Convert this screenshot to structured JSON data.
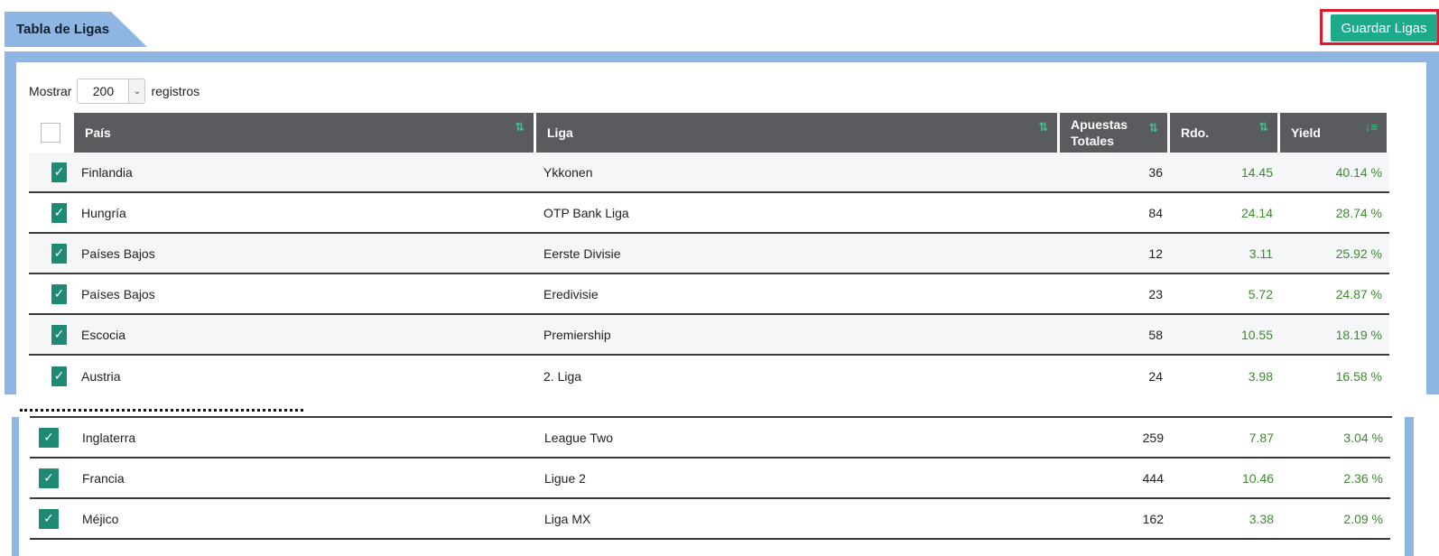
{
  "title": "Tabla de Ligas",
  "save_button": "Guardar Ligas",
  "length_menu": {
    "prefix": "Mostrar",
    "value": "200",
    "suffix": "registros"
  },
  "columns": {
    "pais": "País",
    "liga": "Liga",
    "apuestas_line1": "Apuestas",
    "apuestas_line2": "Totales",
    "rdo": "Rdo.",
    "yield": "Yield"
  },
  "rows": [
    {
      "pais": "Finlandia",
      "liga": "Ykkonen",
      "apuestas": "36",
      "rdo": "14.45",
      "yield": "40.14 %"
    },
    {
      "pais": "Hungría",
      "liga": "OTP Bank Liga",
      "apuestas": "84",
      "rdo": "24.14",
      "yield": "28.74 %"
    },
    {
      "pais": "Países Bajos",
      "liga": "Eerste Divisie",
      "apuestas": "12",
      "rdo": "3.11",
      "yield": "25.92 %"
    },
    {
      "pais": "Países Bajos",
      "liga": "Eredivisie",
      "apuestas": "23",
      "rdo": "5.72",
      "yield": "24.87 %"
    },
    {
      "pais": "Escocia",
      "liga": "Premiership",
      "apuestas": "58",
      "rdo": "10.55",
      "yield": "18.19 %"
    },
    {
      "pais": "Austria",
      "liga": "2. Liga",
      "apuestas": "24",
      "rdo": "3.98",
      "yield": "16.58 %"
    },
    {
      "pais": "Inglaterra",
      "liga": "League Two",
      "apuestas": "259",
      "rdo": "7.87",
      "yield": "3.04 %"
    },
    {
      "pais": "Francia",
      "liga": "Ligue 2",
      "apuestas": "444",
      "rdo": "10.46",
      "yield": "2.36 %"
    },
    {
      "pais": "Méjico",
      "liga": "Liga MX",
      "apuestas": "162",
      "rdo": "3.38",
      "yield": "2.09 %"
    }
  ]
}
